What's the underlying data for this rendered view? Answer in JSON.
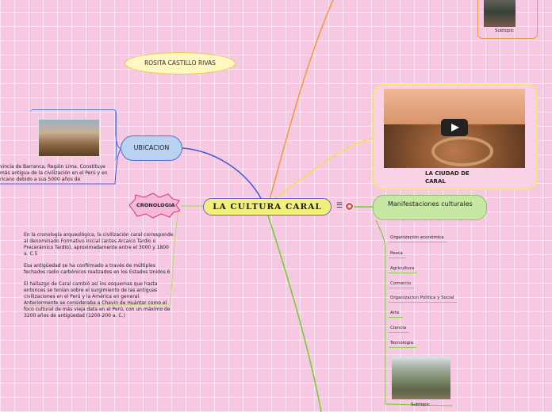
{
  "central": {
    "title": "LA CULTURA CARAL"
  },
  "author": {
    "name": "ROSITA CASTILLO RIVAS"
  },
  "ubicacion": {
    "label": "UBICACION",
    "text_lines": [
      "vincia de Barranca, Región Lima. Constituye",
      "más antigua de la civilización en el Perú y en",
      "ricano debido a sus 5000 años de"
    ]
  },
  "cronologia": {
    "label": "CRONOLOGIA",
    "paragraphs": [
      "En la cronología arqueológica, la civilización caral corresponde al denominado Formativo Inicial (antes Arcaico Tardío o Precerámico Tardío), aproximadamente entre el 3000 y 1800 a. C.5",
      "Esa antigüedad se ha confirmado a través de múltiples fechados radio carbónicos realizados en los Estados Unidos.6",
      "El hallazgo de Caral cambió así los esquemas que hasta entonces se tenían sobre el surgimiento de las antiguas civilizaciones en el Perú y la América en general. Anteriormente se consideraba a Chavín de Huántar como el foco cultural de más vieja data en el Perú, con un máximo de 3200 años de antigüedad (1200-200 a. C.)"
    ]
  },
  "video": {
    "title": "LA CIUDAD DE CARAL"
  },
  "top_subtopic": {
    "label": "Subtopic"
  },
  "manifestaciones": {
    "title": "Manifestaciones culturales",
    "items": [
      "Organización económica",
      "Pesca",
      "Agricultura",
      "Comercio",
      "Organizacion Politica y Social",
      "Arte",
      "Ciencia",
      "Tecnologia"
    ],
    "subtopic": "Subtopic"
  },
  "colors": {
    "ubicacion_line": "#3a5ad6",
    "cronologia_line": "#9ad04a",
    "manifest_line": "#6ccf2a",
    "video_line": "#f2e04a",
    "top_line": "#f09a3a"
  },
  "icons": [
    "notes-icon",
    "map-icon",
    "play-icon"
  ]
}
